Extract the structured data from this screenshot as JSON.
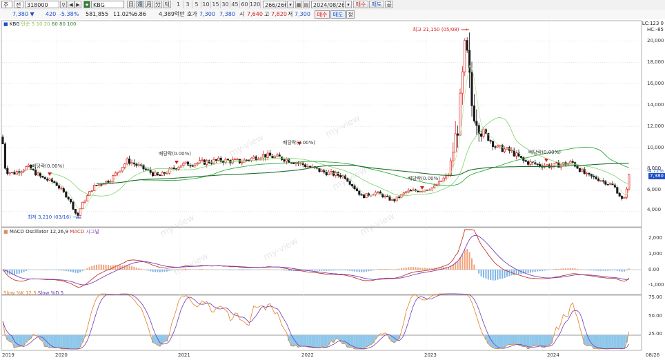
{
  "toolbar": {
    "market_code": "주",
    "market_type": "전",
    "stock_code": "318000",
    "stock_name": "KBG",
    "tool_buttons": [
      "日",
      "週",
      "月",
      "分",
      "틱"
    ],
    "periods": [
      "1",
      "3",
      "5",
      "10",
      "15",
      "30",
      "45",
      "60",
      "120"
    ],
    "count_current": "266",
    "count_total": "266",
    "date": "2024/08/26",
    "buy_sell_label": "매수",
    "sell_label": "매도",
    "gong_label": "공"
  },
  "quote": {
    "price": "7,380",
    "change": "420",
    "change_rate": "-5.38%",
    "volume": "581,855",
    "turnover_pct": "11.02%",
    "amount": "6.86",
    "market_cap": "4,389억만",
    "hoga_label": "호가",
    "hoga_value": "7,300",
    "value2": "7,380",
    "open_label": "시",
    "open": "7,640",
    "high_label": "고",
    "high": "7,820",
    "low_label": "저",
    "low": "7,300",
    "btn_buy": "매수",
    "btn_sell": "매도",
    "btn_other": "정"
  },
  "price_panel": {
    "legend_name": "KBG",
    "legend_ma": "단순 5 10 20",
    "legend_ma2": "60 80 100",
    "top_right_1": "LC:123 0",
    "top_right_2": "HC:-85",
    "pct_label": "-4.72%",
    "last_price_label": "7,380",
    "y_ticks": [
      "20,000",
      "18,000",
      "16,000",
      "14,000",
      "12,000",
      "10,000",
      "8,000",
      "6,000",
      "4,000"
    ],
    "high_annotation": "최고 21,150 (05/08)",
    "low_annotation": "최저 3,210 (03/16)",
    "dividend_annotations": [
      "배당락(0.00%)",
      "배당락(0.00%)",
      "배당락(0.00%)",
      "배당락(0.00%)",
      "배당락(0.00%)"
    ]
  },
  "macd_panel": {
    "legend_a": "MACD Oscillator 12,26,9",
    "legend_b": "MACD",
    "legend_c": "시그널",
    "y_ticks": [
      "2,000",
      "1,000",
      "0.00",
      "-1,000"
    ]
  },
  "stoch_panel": {
    "legend_a": "Slow %K 12,5",
    "legend_b": "Slow %D 5",
    "y_ticks": [
      "75.00",
      "50.00",
      "25.00"
    ]
  },
  "x_axis": [
    "2019",
    "2020",
    "2021",
    "2022",
    "2023",
    "2024",
    "08/26"
  ],
  "watermark": "my-view",
  "colors": {
    "up": "#e0201e",
    "down": "#1a1a1a",
    "macd": "#c0392b",
    "signal": "#7b3fb5",
    "osc_pos": "#f2a27a",
    "osc_neg": "#7fb6e8",
    "slowk": "#e67e22",
    "slowd": "#6c3bb3",
    "stoch_fill": "#8fc7ea"
  }
}
